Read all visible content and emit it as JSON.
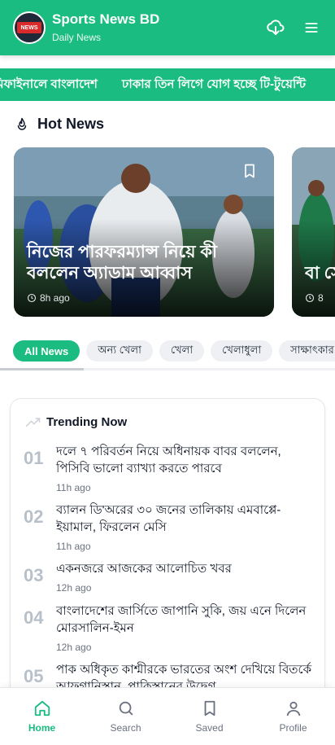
{
  "header": {
    "title": "Sports News BD",
    "subtitle": "Daily News",
    "logo_text": "NEWS"
  },
  "ticker": {
    "items": [
      "মিফাইনালে বাংলাদেশ",
      "ঢাকার তিন লিগে যোগ হচ্ছে টি-টুয়েন্টি"
    ]
  },
  "hot_news": {
    "title": "Hot News",
    "cards": [
      {
        "headline": "নিজের পারফরম্যান্স নিয়ে কী বললেন অ্যাডাম আব্বাস",
        "time": "8h ago"
      },
      {
        "headline": "বা সে",
        "time": "8"
      }
    ]
  },
  "categories": {
    "items": [
      "All News",
      "অন্য খেলা",
      "খেলা",
      "খেলাধুলা",
      "সাক্ষাৎকার"
    ],
    "active": "All News"
  },
  "trending": {
    "title": "Trending Now",
    "items": [
      {
        "rank": "01",
        "text": "দলে ৭ পরিবর্তন নিয়ে অধিনায়ক বাবর বললেন, পিসিবি ভালো ব্যাখ্যা করতে পারবে",
        "time": "11h ago"
      },
      {
        "rank": "02",
        "text": "ব্যালন ডি'অরের ৩০ জনের তালিকায় এমবাপ্পে-ইয়ামাল, ফিরলেন মেসি",
        "time": "11h ago"
      },
      {
        "rank": "03",
        "text": "একনজরে আজকের আলোচিত খবর",
        "time": "12h ago"
      },
      {
        "rank": "04",
        "text": "বাংলাদেশের জার্সিতে জাপানি সুকি, জয় এনে দিলেন মোরসালিন-ইমন",
        "time": "12h ago"
      },
      {
        "rank": "05",
        "text": "পাক অধিকৃত কাশ্মীরকে ভারতের অংশ দেখিয়ে বিতর্কে আফগানিস্তান, পাকিস্তানের উদ্বেগ",
        "time": ""
      }
    ]
  },
  "bottom_nav": {
    "items": [
      "Home",
      "Search",
      "Saved",
      "Profile"
    ],
    "active": "Home"
  },
  "colors": {
    "accent": "#1bbc82",
    "muted_rank": "#b8c0ca"
  },
  "icons": {
    "header": [
      "cloud-download-icon",
      "menu-icon"
    ],
    "hot_news": "fire-icon",
    "trending": "trending-up-icon",
    "nav": [
      "home-icon",
      "search-icon",
      "bookmark-icon",
      "user-icon"
    ]
  }
}
